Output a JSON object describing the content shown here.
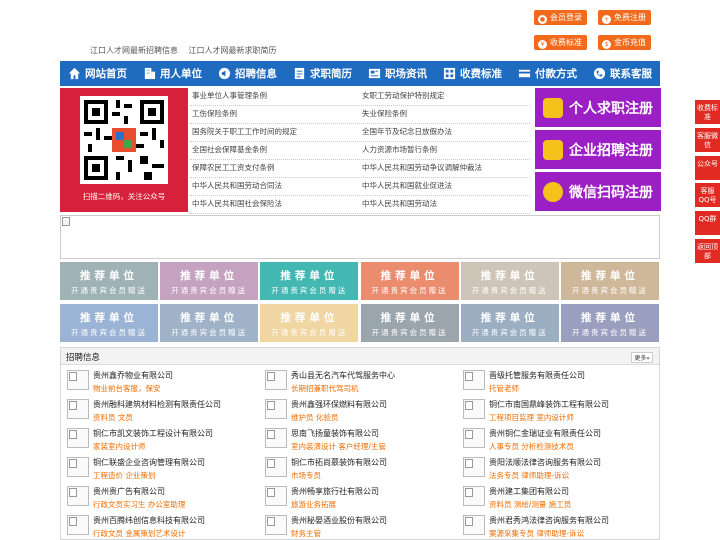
{
  "topbar": {
    "tagline": [
      "江口人才网最新招聘信息",
      "江口人才网最新求职简历"
    ],
    "buttons": [
      {
        "label": "会员登录",
        "icon": "user-icon"
      },
      {
        "label": "免费注册",
        "icon": "register-icon"
      },
      {
        "label": "收费标准",
        "icon": "yen-icon"
      },
      {
        "label": "金币充值",
        "icon": "coin-icon"
      }
    ]
  },
  "nav": [
    {
      "label": "网站首页",
      "icon": "home-icon"
    },
    {
      "label": "用人单位",
      "icon": "building-icon"
    },
    {
      "label": "招聘信息",
      "icon": "megaphone-icon"
    },
    {
      "label": "求职简历",
      "icon": "resume-icon"
    },
    {
      "label": "职场资讯",
      "icon": "news-icon"
    },
    {
      "label": "收费标准",
      "icon": "fee-icon"
    },
    {
      "label": "付款方式",
      "icon": "payment-icon"
    },
    {
      "label": "联系客服",
      "icon": "phone-icon"
    }
  ],
  "qr": {
    "caption": "扫描二维码，关注公众号"
  },
  "laws": [
    [
      "事业单位人事管理条例",
      "女职工劳动保护特别规定"
    ],
    [
      "工伤保险条例",
      "失业保险条例"
    ],
    [
      "国务院关于职工工作时间的规定",
      "全国年节及纪念日放假办法"
    ],
    [
      "全国社会保障基金条例",
      "人力资源市场暂行条例"
    ],
    [
      "保障农民工工资支付条例",
      "中华人民共和国劳动争议调解仲裁法"
    ],
    [
      "中华人民共和国劳动合同法",
      "中华人民共和国就业促进法"
    ],
    [
      "中华人民共和国社会保险法",
      "中华人民共和国劳动法"
    ]
  ],
  "register": [
    {
      "label": "个人求职注册",
      "icon": "person-icon"
    },
    {
      "label": "企业招聘注册",
      "icon": "company-icon"
    },
    {
      "label": "微信扫码注册",
      "icon": "wechat-icon"
    }
  ],
  "recommend": {
    "title": "推荐单位",
    "sub": "开通贵宾会员赠送",
    "colors": [
      "#9fb3b6",
      "#c5a3c0",
      "#43b7b2",
      "#eb8c6e",
      "#cec5b8",
      "#cfb79a",
      "#9bb3d4",
      "#9fb2c7",
      "#efd6a2",
      "#9aa5ad",
      "#9baec2",
      "#9a9fbf"
    ]
  },
  "jobs": {
    "title": "招聘信息",
    "more": "更多»",
    "columns": [
      [
        {
          "company": "贵州鑫乔物业有限公司",
          "positions": "物业前台客服，保安"
        },
        {
          "company": "贵州融科建筑材料检测有限责任公司",
          "positions": "资料员 文员"
        },
        {
          "company": "铜仁市凯文装饰工程设计有限公司",
          "positions": "家装室内设计师"
        },
        {
          "company": "铜仁联盛企业咨询管理有限公司",
          "positions": "工程造价 企业策划"
        },
        {
          "company": "贵州贵广告有限公司",
          "positions": "行政文员实习生 办公室助理"
        },
        {
          "company": "贵州百腾纬创信息科技有限公司",
          "positions": "行政文员 金属策划艺术设计"
        }
      ],
      [
        {
          "company": "秀山县无名汽车代驾服务中心",
          "positions": "长期招兼职代驾司机"
        },
        {
          "company": "贵州鑫强环保燃料有限公司",
          "positions": "维护员 化验员"
        },
        {
          "company": "思南飞扬童装饰有限公司",
          "positions": "室内装潢设计 客户经理/主管"
        },
        {
          "company": "铜仁市拓尚慕装饰有限公司",
          "positions": "市场专员"
        },
        {
          "company": "贵州畅享旅行社有限公司",
          "positions": "旅游业务拓展"
        },
        {
          "company": "贵州秘晏酒业股份有限公司",
          "positions": "财务主管"
        }
      ],
      [
        {
          "company": "晋级托管服务有限责任公司",
          "positions": "托管老师"
        },
        {
          "company": "铜仁市南国鼎峰装饰工程有限公司",
          "positions": "工程项目监理 室内设计师"
        },
        {
          "company": "贵州铜仁金瑞证业有限责任公司",
          "positions": "人事专员 分析检测技术员"
        },
        {
          "company": "贵阳法顺法律咨询服务有限公司",
          "positions": "法务专员 律师助理-诉讼"
        },
        {
          "company": "贵州建工集团有限公司",
          "positions": "资料员 测绘/测量 施工员"
        },
        {
          "company": "贵州君秀鸿法律咨询服务有限公司",
          "positions": "案源采集专员 律师助理-诉讼"
        }
      ]
    ]
  },
  "float": [
    "收费标准",
    "客服微信",
    "公众号",
    "客服QQ号",
    "QQ群",
    "返回顶部"
  ]
}
